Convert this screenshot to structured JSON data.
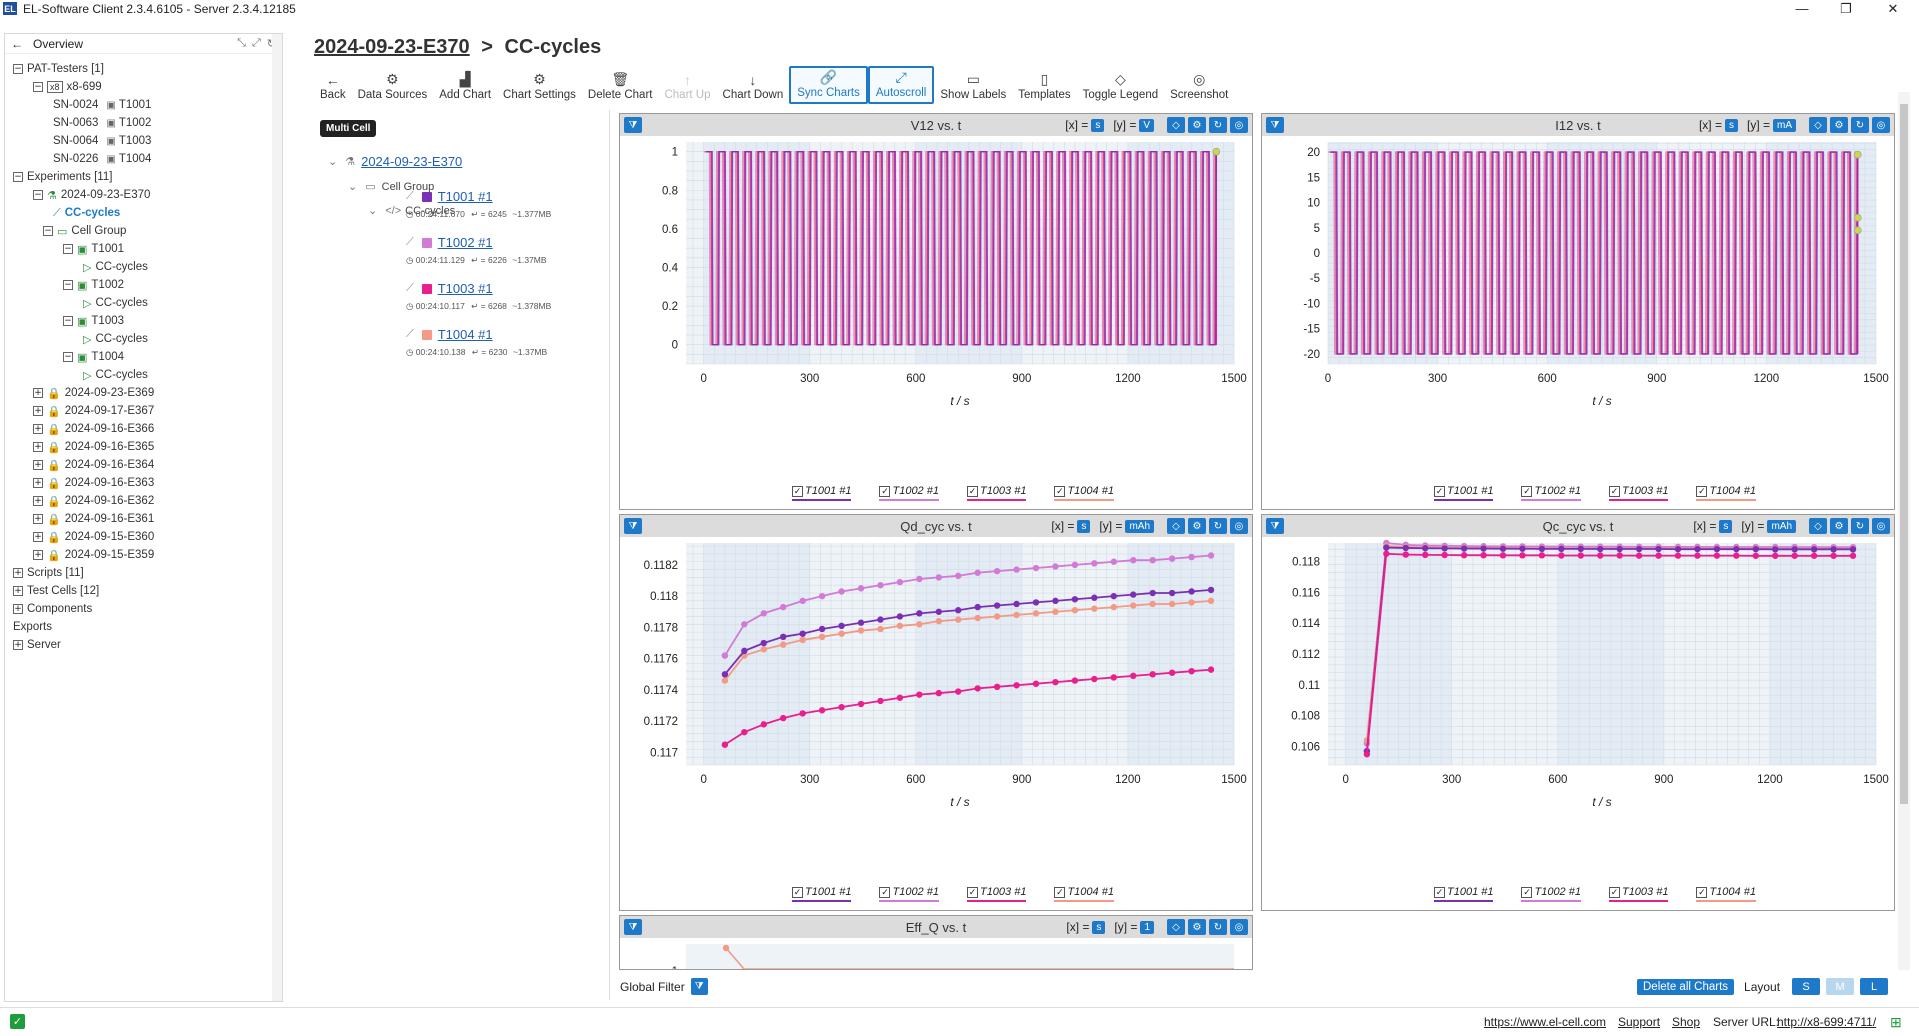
{
  "window": {
    "title": "EL-Software Client 2.3.4.6105 - Server 2.3.4.12185",
    "app_icon": "EL",
    "controls": [
      "—",
      "❐",
      "✕"
    ]
  },
  "overview": {
    "label": "Overview"
  },
  "tree": [
    {
      "label": "PAT-Testers [1]",
      "lvl": 0,
      "pm": "−"
    },
    {
      "label": "x8-699",
      "lvl": 1,
      "pm": "−",
      "tag": "x8"
    },
    {
      "label": "SN-0024",
      "sub": "T1001",
      "lvl": 2
    },
    {
      "label": "SN-0063",
      "sub": "T1002",
      "lvl": 2
    },
    {
      "label": "SN-0064",
      "sub": "T1003",
      "lvl": 2
    },
    {
      "label": "SN-0226",
      "sub": "T1004",
      "lvl": 2
    },
    {
      "label": "Experiments [11]",
      "lvl": 0,
      "pm": "−"
    },
    {
      "label": "2024-09-23-E370",
      "lvl": 1,
      "pm": "−",
      "icon": "flask"
    },
    {
      "label": "CC-cycles",
      "lvl": 2,
      "icon": "chart",
      "selected": true
    },
    {
      "label": "Cell Group",
      "lvl": 1.5,
      "pm": "−",
      "icon": "folder"
    },
    {
      "label": "T1001",
      "lvl": 2.5,
      "pm": "−",
      "icon": "cell"
    },
    {
      "label": "CC-cycles",
      "lvl": 3.5,
      "icon": "play"
    },
    {
      "label": "T1002",
      "lvl": 2.5,
      "pm": "−",
      "icon": "cell"
    },
    {
      "label": "CC-cycles",
      "lvl": 3.5,
      "icon": "play"
    },
    {
      "label": "T1003",
      "lvl": 2.5,
      "pm": "−",
      "icon": "cell"
    },
    {
      "label": "CC-cycles",
      "lvl": 3.5,
      "icon": "play"
    },
    {
      "label": "T1004",
      "lvl": 2.5,
      "pm": "−",
      "icon": "cell"
    },
    {
      "label": "CC-cycles",
      "lvl": 3.5,
      "icon": "play"
    },
    {
      "label": "2024-09-23-E369",
      "lvl": 1,
      "pm": "+",
      "icon": "lock"
    },
    {
      "label": "2024-09-17-E367",
      "lvl": 1,
      "pm": "+",
      "icon": "lock"
    },
    {
      "label": "2024-09-16-E366",
      "lvl": 1,
      "pm": "+",
      "icon": "lock"
    },
    {
      "label": "2024-09-16-E365",
      "lvl": 1,
      "pm": "+",
      "icon": "lock"
    },
    {
      "label": "2024-09-16-E364",
      "lvl": 1,
      "pm": "+",
      "icon": "lock"
    },
    {
      "label": "2024-09-16-E363",
      "lvl": 1,
      "pm": "+",
      "icon": "lock"
    },
    {
      "label": "2024-09-16-E362",
      "lvl": 1,
      "pm": "+",
      "icon": "lock"
    },
    {
      "label": "2024-09-16-E361",
      "lvl": 1,
      "pm": "+",
      "icon": "lock"
    },
    {
      "label": "2024-09-15-E360",
      "lvl": 1,
      "pm": "+",
      "icon": "lock"
    },
    {
      "label": "2024-09-15-E359",
      "lvl": 1,
      "pm": "+",
      "icon": "lock"
    },
    {
      "label": "Scripts [11]",
      "lvl": 0,
      "pm": "+"
    },
    {
      "label": "Test Cells [12]",
      "lvl": 0,
      "pm": "+"
    },
    {
      "label": "Components",
      "lvl": 0,
      "pm": "+"
    },
    {
      "label": "Exports",
      "lvl": 0
    },
    {
      "label": "Server",
      "lvl": 0,
      "pm": "+"
    }
  ],
  "breadcrumb": {
    "experiment": "2024-09-23-E370",
    "sep": ">",
    "current": "CC-cycles"
  },
  "toolbar": [
    {
      "label": "Back",
      "icon": "←"
    },
    {
      "label": "Data Sources",
      "icon": "⚙"
    },
    {
      "label": "Add Chart",
      "icon": "▟"
    },
    {
      "label": "Chart Settings",
      "icon": "⚙"
    },
    {
      "label": "Delete Chart",
      "icon": "🗑"
    },
    {
      "label": "Chart Up",
      "icon": "↑",
      "disabled": true
    },
    {
      "label": "Chart Down",
      "icon": "↓"
    },
    {
      "label": "Sync Charts",
      "icon": "🔗",
      "active": true
    },
    {
      "label": "Autoscroll",
      "icon": "⤢",
      "active": true
    },
    {
      "label": "Show Labels",
      "icon": "▭"
    },
    {
      "label": "Templates",
      "icon": "▯"
    },
    {
      "label": "Toggle Legend",
      "icon": "◇"
    },
    {
      "label": "Screenshot",
      "icon": "◎"
    }
  ],
  "datasources": {
    "badge": "Multi Cell",
    "experiment": "2024-09-23-E370",
    "group": "Cell Group",
    "script": "CC-cycles",
    "cells": [
      {
        "name": "T1001 #1",
        "color": "#7a2fb5",
        "time": "00:24:11.670",
        "points": "6245",
        "size": "~1.377MB"
      },
      {
        "name": "T1002 #1",
        "color": "#d17ad6",
        "time": "00:24:11.129",
        "points": "6226",
        "size": "~1.37MB"
      },
      {
        "name": "T1003 #1",
        "color": "#e81f8c",
        "time": "00:24:10.117",
        "points": "6268",
        "size": "~1.378MB"
      },
      {
        "name": "T1004 #1",
        "color": "#f29a86",
        "time": "00:24:10.138",
        "points": "6230",
        "size": "~1.37MB"
      }
    ]
  },
  "series_names": [
    "T1001 #1",
    "T1002 #1",
    "T1003 #1",
    "T1004 #1"
  ],
  "series_colors": [
    "#7a2fb5",
    "#d17ad6",
    "#e81f8c",
    "#f29a86"
  ],
  "charts": [
    {
      "title": "V12 vs. t",
      "x_unit": "s",
      "y_unit": "V",
      "xlabel": "t / s"
    },
    {
      "title": "I12 vs. t",
      "x_unit": "s",
      "y_unit": "mA",
      "xlabel": "t / s"
    },
    {
      "title": "Qd_cyc vs. t",
      "x_unit": "s",
      "y_unit": "mAh",
      "xlabel": "t / s"
    },
    {
      "title": "Qc_cyc vs. t",
      "x_unit": "s",
      "y_unit": "mAh",
      "xlabel": "t / s"
    },
    {
      "title": "Eff_Q vs. t",
      "x_unit": "s",
      "y_unit": "1"
    }
  ],
  "chart_data": [
    {
      "type": "line",
      "title": "V12 vs. t",
      "xlabel": "t / s",
      "xlim": [
        -50,
        1500
      ],
      "ylim": [
        -0.1,
        1.05
      ],
      "xticks": [
        0,
        300,
        600,
        900,
        1200,
        1500
      ],
      "yticks": [
        0,
        0.2,
        0.4,
        0.6,
        0.8,
        1
      ],
      "ytick_labels": [
        "0",
        "0.2",
        "0.4",
        "0.6",
        "0.8",
        "1"
      ],
      "pattern": "square-wave",
      "period_s": 37,
      "ymin": 0,
      "ymax": 1,
      "t_start": 0,
      "t_end": 1450,
      "end_marker": [
        1450,
        1.0
      ]
    },
    {
      "type": "line",
      "title": "I12 vs. t",
      "xlabel": "t / s",
      "xlim": [
        0,
        1500
      ],
      "ylim": [
        -22,
        22
      ],
      "xticks": [
        0,
        300,
        600,
        900,
        1200,
        1500
      ],
      "yticks": [
        -20,
        -15,
        -10,
        -5,
        0,
        5,
        10,
        15,
        20
      ],
      "ytick_labels": [
        "-20",
        "-15",
        "-10",
        "-5",
        "0",
        "5",
        "10",
        "15",
        "20"
      ],
      "pattern": "square-wave",
      "period_s": 37,
      "ymin": -20,
      "ymax": 20,
      "t_start": 0,
      "t_end": 1450,
      "end_markers": [
        [
          1450,
          19.5
        ],
        [
          1450,
          7
        ],
        [
          1450,
          4.5
        ]
      ]
    },
    {
      "type": "line",
      "title": "Qd_cyc vs. t",
      "xlabel": "t / s",
      "xlim": [
        -50,
        1500
      ],
      "ylim": [
        0.11692,
        0.11834
      ],
      "xticks": [
        0,
        300,
        600,
        900,
        1200,
        1500
      ],
      "yticks": [
        0.117,
        0.1172,
        0.1174,
        0.1176,
        0.1178,
        0.118,
        0.1182
      ],
      "ytick_labels": [
        "0.117",
        "0.1172",
        "0.1174",
        "0.1176",
        "0.1178",
        "0.118",
        "0.1182"
      ],
      "x": [
        60,
        115,
        170,
        225,
        280,
        335,
        390,
        445,
        500,
        555,
        610,
        665,
        720,
        775,
        830,
        885,
        940,
        995,
        1050,
        1105,
        1160,
        1215,
        1270,
        1325,
        1380,
        1435
      ],
      "series": [
        {
          "name": "T1001 #1",
          "values": [
            0.1175,
            0.11765,
            0.1177,
            0.11774,
            0.11776,
            0.11779,
            0.11781,
            0.11783,
            0.11785,
            0.11787,
            0.11789,
            0.1179,
            0.11791,
            0.11793,
            0.11794,
            0.11795,
            0.11796,
            0.11797,
            0.11798,
            0.11799,
            0.118,
            0.11801,
            0.11802,
            0.11802,
            0.11803,
            0.11804
          ]
        },
        {
          "name": "T1002 #1",
          "values": [
            0.11762,
            0.11782,
            0.11789,
            0.11793,
            0.11797,
            0.118,
            0.11803,
            0.11805,
            0.11807,
            0.11809,
            0.11811,
            0.11812,
            0.11813,
            0.11815,
            0.11816,
            0.11817,
            0.11818,
            0.11819,
            0.1182,
            0.11821,
            0.11822,
            0.11823,
            0.11823,
            0.11824,
            0.11825,
            0.11826
          ]
        },
        {
          "name": "T1003 #1",
          "values": [
            0.11705,
            0.11713,
            0.11718,
            0.11722,
            0.11725,
            0.11727,
            0.11729,
            0.11731,
            0.11733,
            0.11735,
            0.11737,
            0.11738,
            0.11739,
            0.11741,
            0.11742,
            0.11743,
            0.11744,
            0.11745,
            0.11746,
            0.11747,
            0.11748,
            0.11749,
            0.1175,
            0.11751,
            0.11752,
            0.11753
          ]
        },
        {
          "name": "T1004 #1",
          "values": [
            0.11746,
            0.11762,
            0.11766,
            0.11769,
            0.11772,
            0.11774,
            0.11776,
            0.11778,
            0.11779,
            0.11781,
            0.11782,
            0.11784,
            0.11785,
            0.11786,
            0.11787,
            0.11788,
            0.11789,
            0.1179,
            0.11791,
            0.11792,
            0.11793,
            0.11794,
            0.11795,
            0.11795,
            0.11796,
            0.11797
          ]
        }
      ]
    },
    {
      "type": "line",
      "title": "Qc_cyc vs. t",
      "xlabel": "t / s",
      "xlim": [
        -50,
        1500
      ],
      "ylim": [
        0.1048,
        0.1192
      ],
      "xticks": [
        0,
        300,
        600,
        900,
        1200,
        1500
      ],
      "yticks": [
        0.106,
        0.108,
        0.11,
        0.112,
        0.114,
        0.116,
        0.118
      ],
      "ytick_labels": [
        "0.106",
        "0.108",
        "0.11",
        "0.112",
        "0.114",
        "0.116",
        "0.118"
      ],
      "x": [
        60,
        115,
        170,
        225,
        280,
        335,
        390,
        445,
        500,
        555,
        610,
        665,
        720,
        775,
        830,
        885,
        940,
        995,
        1050,
        1105,
        1160,
        1215,
        1270,
        1325,
        1380,
        1435
      ],
      "series": [
        {
          "name": "T1001 #1",
          "values": [
            0.1057,
            0.1189,
            0.11888,
            0.11886,
            0.11885,
            0.11884,
            0.11884,
            0.11883,
            0.11883,
            0.11882,
            0.11882,
            0.11882,
            0.11881,
            0.11881,
            0.11881,
            0.11881,
            0.1188,
            0.1188,
            0.1188,
            0.1188,
            0.1188,
            0.11879,
            0.11879,
            0.11879,
            0.11879,
            0.11879
          ]
        },
        {
          "name": "T1002 #1",
          "values": [
            0.1062,
            0.1192,
            0.11908,
            0.11904,
            0.11902,
            0.119,
            0.11899,
            0.11898,
            0.11898,
            0.11897,
            0.11897,
            0.11896,
            0.11896,
            0.11896,
            0.11895,
            0.11895,
            0.11895,
            0.11895,
            0.11894,
            0.11894,
            0.11894,
            0.11894,
            0.11894,
            0.11893,
            0.11893,
            0.11893
          ]
        },
        {
          "name": "T1003 #1",
          "values": [
            0.1055,
            0.1185,
            0.11845,
            0.11843,
            0.11842,
            0.11841,
            0.11841,
            0.1184,
            0.1184,
            0.1184,
            0.11839,
            0.11839,
            0.11839,
            0.11839,
            0.11838,
            0.11838,
            0.11838,
            0.11838,
            0.11838,
            0.11838,
            0.11837,
            0.11837,
            0.11837,
            0.11837,
            0.11837,
            0.11837
          ]
        },
        {
          "name": "T1004 #1",
          "values": [
            0.1064,
            0.119,
            0.11895,
            0.11892,
            0.1189,
            0.11889,
            0.11888,
            0.11888,
            0.11887,
            0.11887,
            0.11886,
            0.11886,
            0.11886,
            0.11885,
            0.11885,
            0.11885,
            0.11885,
            0.11884,
            0.11884,
            0.11884,
            0.11884,
            0.11884,
            0.11883,
            0.11883,
            0.11883,
            0.11883
          ]
        }
      ]
    },
    {
      "type": "line",
      "title": "Eff_Q vs. t",
      "xlim": [
        -50,
        1500
      ],
      "ytick_labels": [
        "1"
      ],
      "partial": true
    }
  ],
  "global_filter": {
    "label": "Global Filter"
  },
  "bottom": {
    "delete_all": "Delete all Charts",
    "layout_label": "Layout",
    "layouts": [
      "S",
      "M",
      "L"
    ]
  },
  "status": {
    "website": "https://www.el-cell.com",
    "support": "Support",
    "shop": "Shop",
    "server_label": "Server URL:",
    "server_url": "http://x8-699:4711/"
  }
}
